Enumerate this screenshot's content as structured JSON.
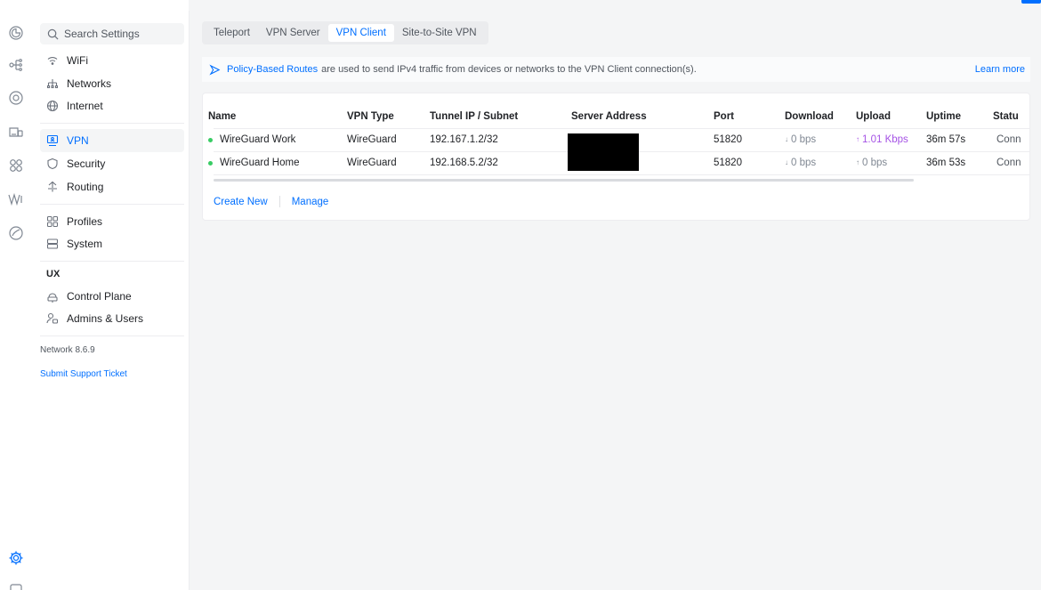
{
  "search": {
    "placeholder": "Search Settings"
  },
  "sidebar": {
    "items": [
      {
        "label": "WiFi",
        "icon": "wifi-icon"
      },
      {
        "label": "Networks",
        "icon": "networks-icon"
      },
      {
        "label": "Internet",
        "icon": "globe-icon"
      },
      {
        "label": "VPN",
        "icon": "vpn-icon",
        "active": true
      },
      {
        "label": "Security",
        "icon": "shield-icon"
      },
      {
        "label": "Routing",
        "icon": "routing-icon"
      },
      {
        "label": "Profiles",
        "icon": "profiles-icon"
      },
      {
        "label": "System",
        "icon": "system-icon"
      }
    ],
    "ux_section": "UX",
    "ux_items": [
      {
        "label": "Control Plane",
        "icon": "control-plane-icon"
      },
      {
        "label": "Admins & Users",
        "icon": "admins-icon"
      }
    ],
    "version": "Network 8.6.9",
    "support": "Submit Support Ticket"
  },
  "tabs": [
    {
      "label": "Teleport"
    },
    {
      "label": "VPN Server"
    },
    {
      "label": "VPN Client",
      "active": true
    },
    {
      "label": "Site-to-Site VPN"
    }
  ],
  "banner": {
    "link": "Policy-Based Routes",
    "text": "are used to send IPv4 traffic from devices or networks to the VPN Client connection(s).",
    "learn_more": "Learn more"
  },
  "table": {
    "columns": [
      "Name",
      "VPN Type",
      "Tunnel IP / Subnet",
      "Server Address",
      "Port",
      "Download",
      "Upload",
      "Uptime",
      "Statu"
    ],
    "rows": [
      {
        "name": "WireGuard Work",
        "type": "WireGuard",
        "tunnel": "192.167.1.2/32",
        "port": "51820",
        "download": "0 bps",
        "upload": "1.01 Kbps",
        "uptime": "36m 57s",
        "status": "Conn"
      },
      {
        "name": "WireGuard Home",
        "type": "WireGuard",
        "tunnel": "192.168.5.2/32",
        "port": "51820",
        "download": "0 bps",
        "upload": "0 bps",
        "uptime": "36m 53s",
        "status": "Conn"
      }
    ],
    "arrow_down": "↓",
    "arrow_up": "↑"
  },
  "actions": {
    "create": "Create New",
    "manage": "Manage"
  },
  "colors": {
    "accent": "#006fff",
    "online": "#39cc64",
    "upload_active": "#a552e5"
  }
}
